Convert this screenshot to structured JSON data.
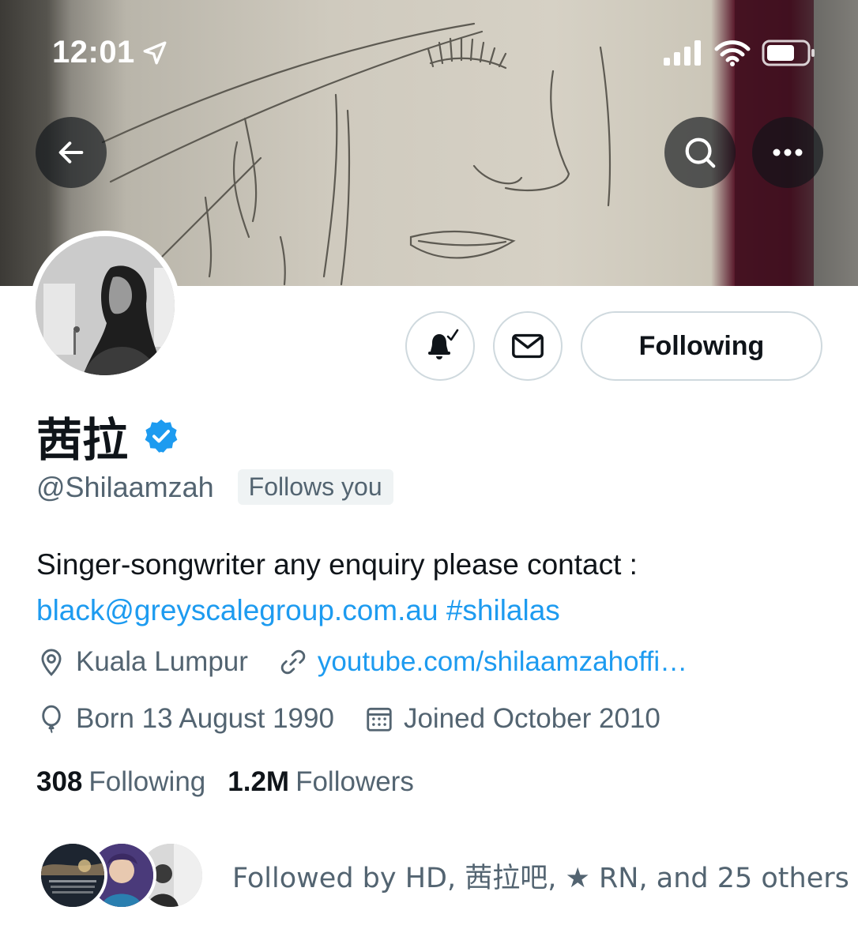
{
  "status_bar": {
    "time": "12:01"
  },
  "profile": {
    "display_name": "茜拉",
    "handle": "@Shilaamzah",
    "follows_you": "Follows you",
    "bio_text": "Singer-songwriter any enquiry please contact :",
    "bio_email": "black@greyscalegroup.com.au",
    "bio_hashtag": "#shilalas",
    "location": "Kuala Lumpur",
    "website": "youtube.com/shilaamzahoffi…",
    "birthday": "Born 13 August 1990",
    "joined": "Joined October 2010",
    "following_count": "308",
    "following_label": "Following",
    "followers_count": "1.2M",
    "followers_label": "Followers",
    "followed_by": "Followed by HD, 茜拉吧, ★ RN, and 25 others"
  },
  "actions": {
    "following_button": "Following"
  },
  "colors": {
    "accent": "#1d9bf0",
    "secondary_text": "#536471",
    "verified": "#1d9bf0"
  },
  "icons": [
    "location-arrow-icon",
    "signal-icon",
    "wifi-icon",
    "battery-icon",
    "back-arrow-icon",
    "search-icon",
    "more-icon",
    "bell-icon",
    "mail-icon",
    "verified-icon",
    "location-pin-icon",
    "link-icon",
    "balloon-icon",
    "calendar-icon"
  ]
}
